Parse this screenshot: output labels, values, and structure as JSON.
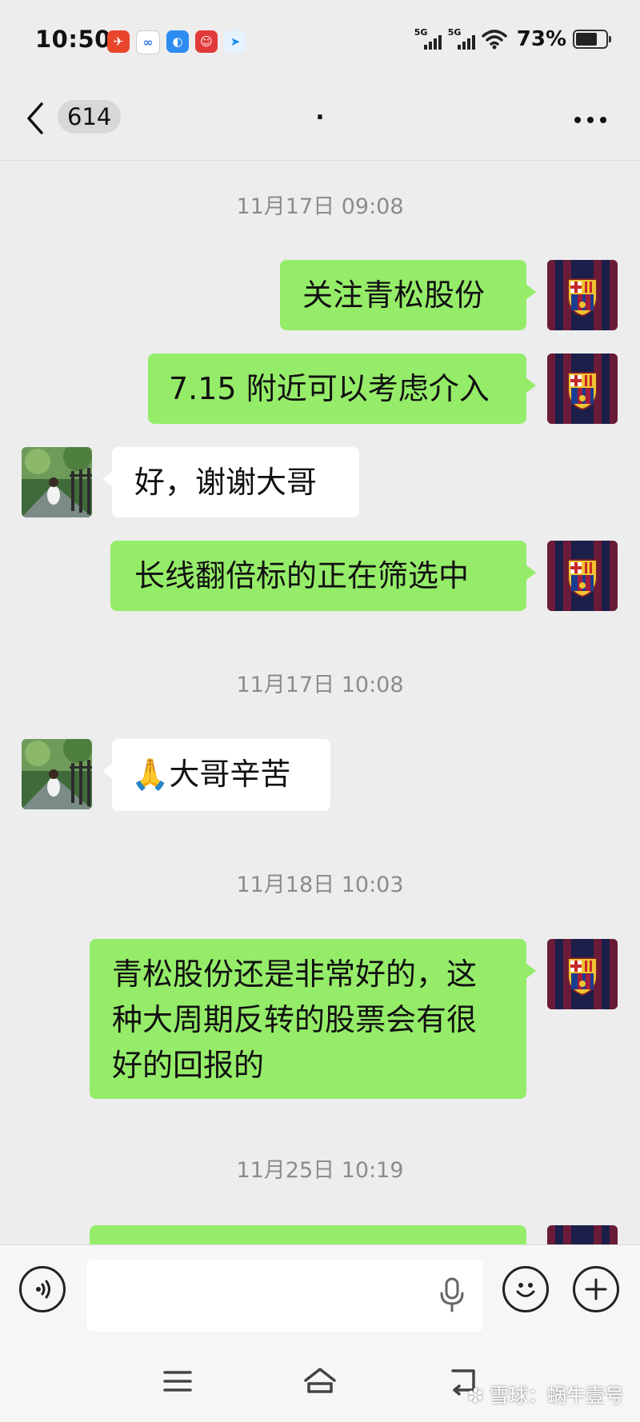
{
  "status_bar": {
    "time": "10:50",
    "signal_1": "5G",
    "signal_2": "5G",
    "battery": "73%"
  },
  "header": {
    "unread_count": "614",
    "title": "."
  },
  "messages": {
    "ts1": "11月17日 09:08",
    "m1": "关注青松股份",
    "m2": "7.15 附近可以考虑介入",
    "m3": "好，谢谢大哥",
    "m4": "长线翻倍标的正在筛选中",
    "ts2": "11月17日 10:08",
    "m5_emoji": "🙏",
    "m5": "大哥辛苦",
    "ts3": "11月18日 10:03",
    "m6": "青松股份还是非常好的，这种大周期反转的股票会有很好的回报的",
    "ts4": "11月25日 10:19"
  },
  "input": {
    "value": "",
    "placeholder": ""
  },
  "watermark": "雪球：蜗牛壹号",
  "colors": {
    "background": "#ededed",
    "my_bubble": "#95ec69",
    "other_bubble": "#ffffff"
  }
}
